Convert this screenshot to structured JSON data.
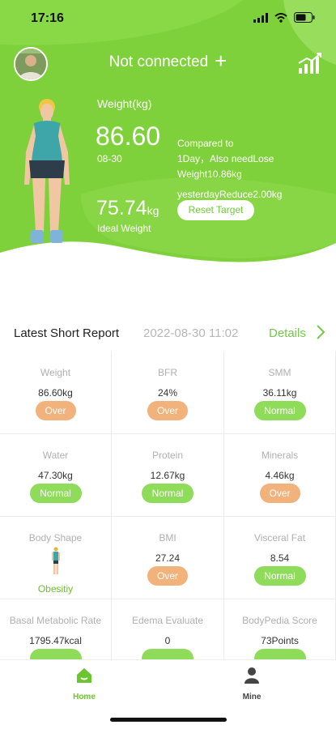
{
  "status": {
    "time": "17:16"
  },
  "header": {
    "connection_title": "Not connected",
    "plus": "+",
    "weight_label": "Weight(kg)",
    "weight_value": "86.60",
    "weight_date": "08-30",
    "compare_line1": "Compared to",
    "compare_line2": "1Day，Also needLose",
    "compare_line3": "Weight10.86kg",
    "compare_line4": "yesterdayReduce2.00kg",
    "ideal_value": "75.74",
    "ideal_unit": "kg",
    "ideal_label": "Ideal Weight",
    "reset_button": "Reset Target"
  },
  "report": {
    "title": "Latest Short Report",
    "datetime": "2022-08-30 11:02",
    "details_link": "Details"
  },
  "metrics": [
    {
      "label": "Weight",
      "value": "86.60kg",
      "status": "Over",
      "kind": "over"
    },
    {
      "label": "BFR",
      "value": "24%",
      "status": "Over",
      "kind": "over"
    },
    {
      "label": "SMM",
      "value": "36.11kg",
      "status": "Normal",
      "kind": "normal"
    },
    {
      "label": "Water",
      "value": "47.30kg",
      "status": "Normal",
      "kind": "normal"
    },
    {
      "label": "Protein",
      "value": "12.67kg",
      "status": "Normal",
      "kind": "normal"
    },
    {
      "label": "Minerals",
      "value": "4.46kg",
      "status": "Over",
      "kind": "over"
    },
    {
      "label": "Body Shape",
      "value": "",
      "status": "Obesitiy",
      "kind": "shape"
    },
    {
      "label": "BMI",
      "value": "27.24",
      "status": "Over",
      "kind": "over"
    },
    {
      "label": "Visceral Fat",
      "value": "8.54",
      "status": "Normal",
      "kind": "normal"
    },
    {
      "label": "Basal Metabolic Rate",
      "value": "1795.47kcal",
      "status": "",
      "kind": "normal"
    },
    {
      "label": "Edema Evaluate",
      "value": "0",
      "status": "",
      "kind": "normal"
    },
    {
      "label": "BodyPedia Score",
      "value": "73Points",
      "status": "",
      "kind": "normal"
    }
  ],
  "tabs": {
    "home": "Home",
    "mine": "Mine"
  },
  "colors": {
    "brand_green": "#7fd13b",
    "normal_badge": "#8fdb5a",
    "over_badge": "#f1b27c",
    "active_tab": "#6cc52f"
  }
}
